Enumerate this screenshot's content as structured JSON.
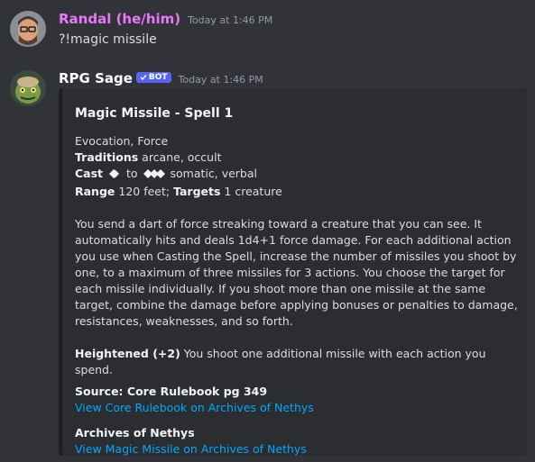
{
  "messages": [
    {
      "username": "Randal (he/him)",
      "username_color": "#e879f9",
      "timestamp": "Today at 1:46 PM",
      "text": "?!magic missile",
      "avatar_icon": "user-avatar"
    },
    {
      "username": "RPG Sage",
      "username_color": "#ffffff",
      "bot_badge": "BOT",
      "timestamp": "Today at 1:46 PM",
      "avatar_icon": "bot-avatar"
    }
  ],
  "embed": {
    "title": "Magic Missile -  Spell 1",
    "traits": "Evocation, Force",
    "traditions_label": "Traditions",
    "traditions_value": " arcane, occult",
    "cast_label": "Cast",
    "cast_to": " to ",
    "cast_components": "somatic, verbal",
    "range_label": "Range",
    "range_value": " 120 feet; ",
    "targets_label": "Targets",
    "targets_value": " 1 creature",
    "description": "You send a dart of force streaking toward a creature that you can see. It automatically hits and deals 1d4+1 force damage. For each additional action you use when Casting the Spell, increase the number of missiles you shoot by one, to a maximum of three missiles for 3 actions. You choose the target for each missile individually. If you shoot more than one missile at the same target, combine the damage before applying bonuses or penalties to damage, resistances, weaknesses, and so forth.",
    "heightened_label": "Heightened (+2)",
    "heightened_text": " You shoot one additional missile with each action you spend.",
    "source": "Source: Core Rulebook pg 349",
    "source_link": "View Core Rulebook on Archives of Nethys",
    "aon_title": "Archives of Nethys",
    "aon_link": "View Magic Missile on Archives of Nethys"
  },
  "colors": {
    "background": "#313338",
    "embed_background": "#2b2d31",
    "link": "#00a8fc",
    "bot_badge": "#5865f2"
  }
}
